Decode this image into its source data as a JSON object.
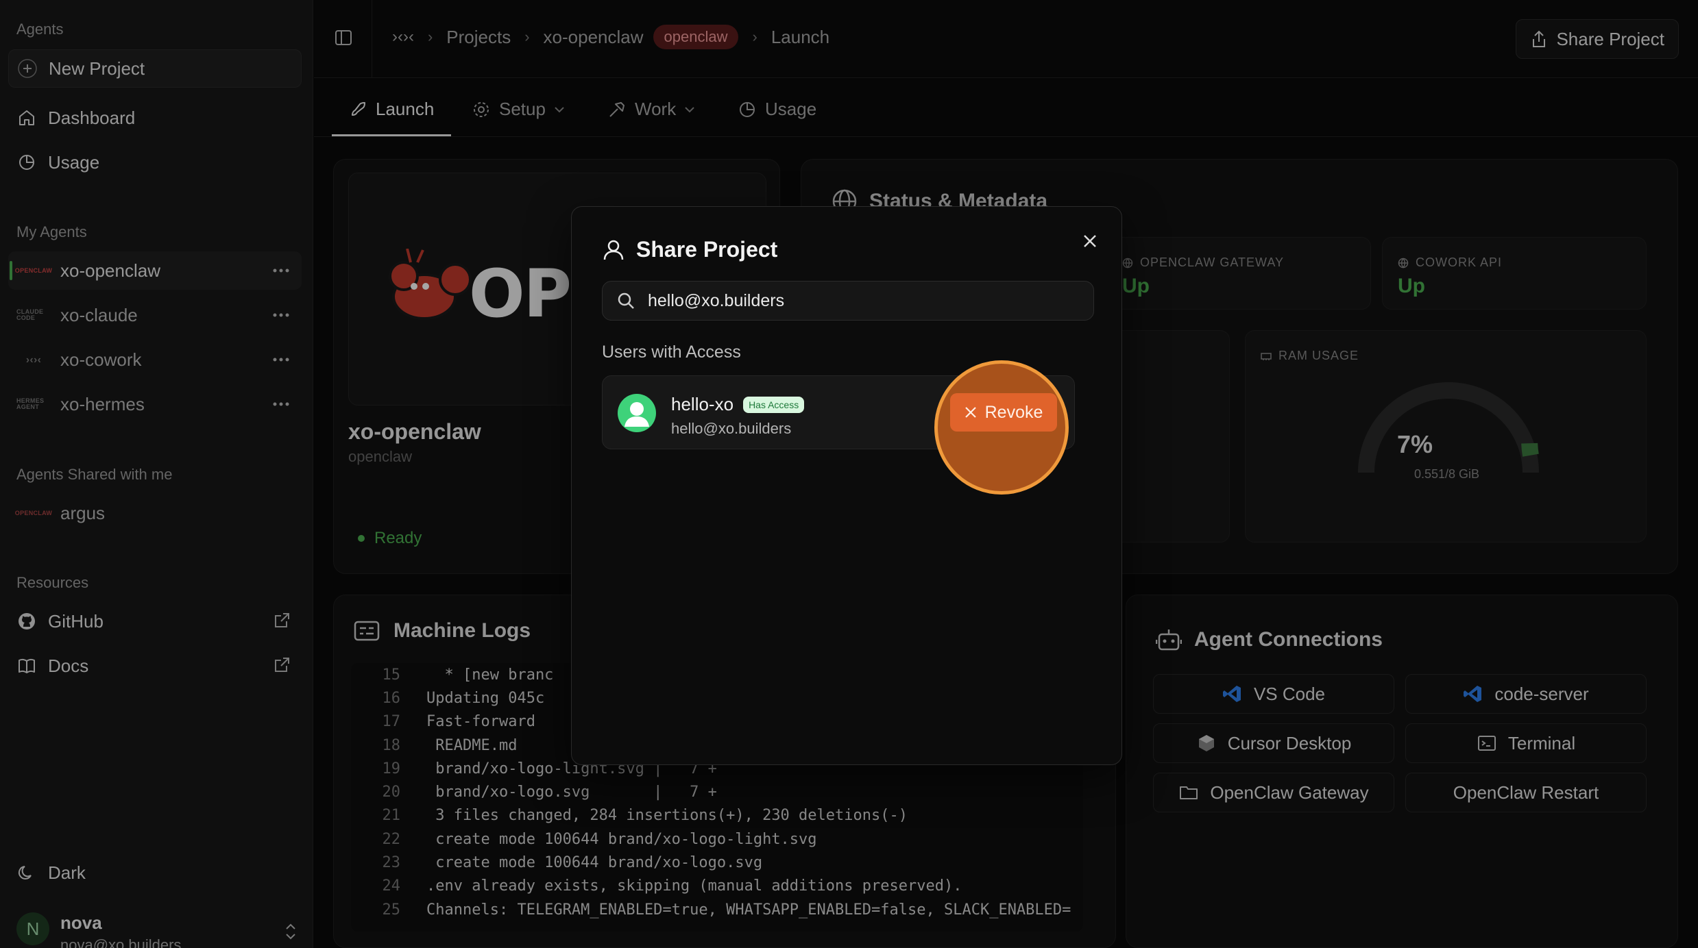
{
  "sidebar": {
    "sections": {
      "agents": "Agents",
      "my_agents": "My Agents",
      "shared": "Agents Shared with me",
      "resources": "Resources"
    },
    "new_project": "New Project",
    "nav": [
      "Dashboard",
      "Usage"
    ],
    "my_agents": [
      {
        "name": "xo-openclaw",
        "logo": "OPENCLAW"
      },
      {
        "name": "xo-claude",
        "logo": "CLAUDE CODE"
      },
      {
        "name": "xo-cowork",
        "logo": "›‹›‹"
      },
      {
        "name": "xo-hermes",
        "logo": "HERMES AGENT"
      }
    ],
    "shared_agents": [
      {
        "name": "argus",
        "logo": "OPENCLAW"
      }
    ],
    "resources": [
      "GitHub",
      "Docs"
    ],
    "theme": "Dark",
    "user": {
      "initial": "N",
      "name": "nova",
      "email": "nova@xo.builders"
    }
  },
  "topbar": {
    "logo": "›‹›‹",
    "crumbs": [
      "Projects",
      "xo-openclaw",
      "Launch"
    ],
    "badge": "openclaw",
    "share": "Share Project"
  },
  "tabs": [
    {
      "label": "Launch",
      "active": true
    },
    {
      "label": "Setup",
      "dropdown": true
    },
    {
      "label": "Work",
      "dropdown": true
    },
    {
      "label": "Usage"
    }
  ],
  "hero": {
    "logo_text": "OPEN",
    "title": "xo-openclaw",
    "subtitle": "openclaw",
    "status": "Ready"
  },
  "status": {
    "title": "Status & Metadata",
    "gateway_label": "OPENCLAW GATEWAY",
    "gateway_value": "Up",
    "cowork_label": "COWORK API",
    "cowork_value": "Up",
    "ram_label": "RAM USAGE",
    "ram_pct": "7%",
    "ram_fraction": 0.07,
    "ram_detail": "0.551/8 GiB"
  },
  "logs": {
    "title": "Machine Logs",
    "lines": [
      {
        "n": "15",
        "t": "  * [new branc"
      },
      {
        "n": "16",
        "t": "Updating 045c"
      },
      {
        "n": "17",
        "t": "Fast-forward"
      },
      {
        "n": "18",
        "t": " README.md"
      },
      {
        "n": "19",
        "t": " brand/xo-logo-light.svg |   7 +"
      },
      {
        "n": "20",
        "t": " brand/xo-logo.svg       |   7 +"
      },
      {
        "n": "21",
        "t": " 3 files changed, 284 insertions(+), 230 deletions(-)"
      },
      {
        "n": "22",
        "t": " create mode 100644 brand/xo-logo-light.svg"
      },
      {
        "n": "23",
        "t": " create mode 100644 brand/xo-logo.svg"
      },
      {
        "n": "24",
        "t": ".env already exists, skipping (manual additions preserved)."
      },
      {
        "n": "25",
        "t": "Channels: TELEGRAM_ENABLED=true, WHATSAPP_ENABLED=false, SLACK_ENABLED="
      }
    ]
  },
  "connections": {
    "title": "Agent Connections",
    "buttons": [
      "VS Code",
      "code-server",
      "Cursor Desktop",
      "Terminal",
      "OpenClaw Gateway",
      "OpenClaw Restart"
    ]
  },
  "modal": {
    "title": "Share Project",
    "search_value": "hello@xo.builders",
    "users_heading": "Users with Access",
    "user": {
      "name": "hello-xo",
      "badge": "Has Access",
      "email": "hello@xo.builders"
    },
    "revoke": "Revoke"
  },
  "colors": {
    "accent_green": "#4caf50",
    "revoke_orange": "#e0632b",
    "badge_red_bg": "#5a1d1d"
  }
}
